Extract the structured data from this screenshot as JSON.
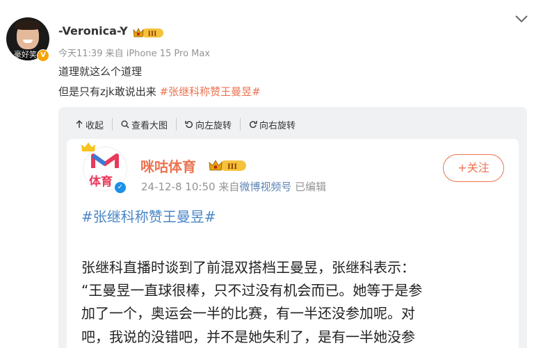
{
  "post": {
    "username": "-Veronica-Y",
    "avatar_watermark": "豪好笑",
    "verify_badge": "V",
    "level_badge": "III",
    "meta": "今天11:39 来自 iPhone 15 Pro Max",
    "text_line1": "道理就这么个道理",
    "text_line2_prefix": "但是只有zjk敢说出来 ",
    "hashtag": "#张继科称赞王曼昱#"
  },
  "toolbar": {
    "collapse": "收起",
    "view_large": "查看大图",
    "rotate_left": "向左旋转",
    "rotate_right": "向右旋转"
  },
  "repost": {
    "media_name": "咪咕体育",
    "logo_text": "体育",
    "level_badge": "III",
    "follow_label": "+关注",
    "date": "24-12-8 10:50",
    "source_prefix": "来自",
    "source_link": "微博视频号",
    "edited": "已编辑",
    "hashtag": "#张继科称赞王曼昱#",
    "lines": [
      "张继科直播时谈到了前混双搭档王曼昱，张继科表示：",
      "“王曼昱一直球很棒，只不过没有机会而已。她等于是参",
      "加了一个，奥运会一半的比赛，有一半还没参加呢。对",
      "吧，我说的没错吧，并不是她失利了，是有一半她没参"
    ]
  },
  "colors": {
    "accent": "#eb7350",
    "link_blue": "#4a86c6",
    "gold": "#f7a300"
  },
  "icons": [
    "chevron-down-icon",
    "arrow-up-icon",
    "search-icon",
    "rotate-left-icon",
    "rotate-right-icon",
    "crown-icon",
    "level-badge-icon"
  ]
}
